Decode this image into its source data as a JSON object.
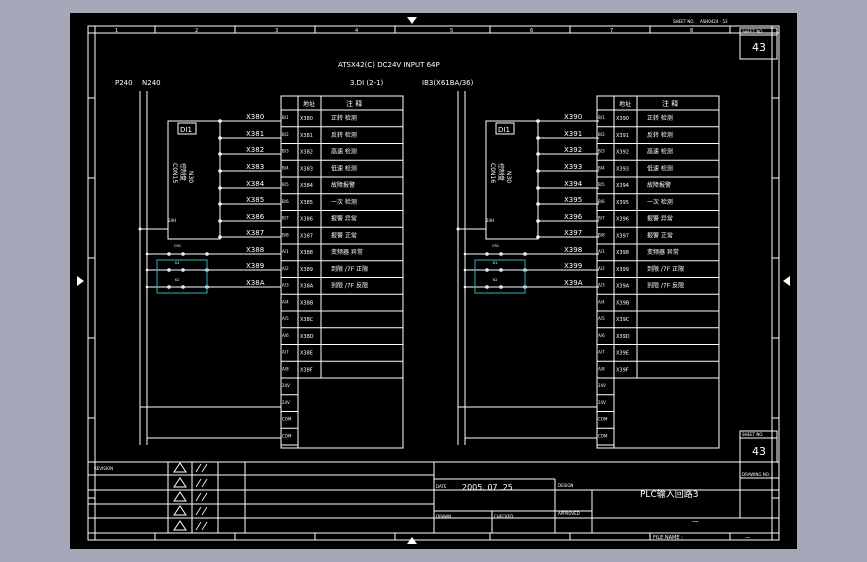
{
  "header": {
    "sheet_code_label": "SHEET NO.",
    "sheet_ref": "ASH0424 - 53",
    "sheet_no_label": "SHEET NO.",
    "sheet_no": "43",
    "title1": "ATSX42(C) DC24V INPUT 64P",
    "title2": "3.DI (2-1)",
    "title3": "IB3(X61BA/36)"
  },
  "grid_numbers": [
    "1",
    "2",
    "3",
    "4",
    "5",
    "6",
    "7",
    "8"
  ],
  "power": {
    "p": "P240",
    "n": "N240"
  },
  "left_panel": {
    "device_label": "C0N15",
    "device_sub": "控制盘",
    "device_sub2": "N30",
    "box_label": "DI1",
    "common_label": "24H",
    "aux1": "CR1",
    "aux2": "K1",
    "aux3": "K2",
    "wires": [
      "X380",
      "X381",
      "X382",
      "X383",
      "X384",
      "X385",
      "X386",
      "X387",
      "X388",
      "X389",
      "X38A"
    ]
  },
  "right_panel": {
    "device_label": "C0N16",
    "device_sub": "控制盘",
    "device_sub2": "N30",
    "box_label": "DI1",
    "common_label": "24H",
    "aux1": "CR1",
    "aux2": "K1",
    "aux3": "K2",
    "wires": [
      "X390",
      "X391",
      "X392",
      "X393",
      "X394",
      "X395",
      "X396",
      "X397",
      "X398",
      "X399",
      "X39A"
    ]
  },
  "left_table": {
    "header_addr": "地址",
    "header_desc": "注 释",
    "pins": [
      "B/1",
      "B/2",
      "B/3",
      "B/4",
      "B/5",
      "B/6",
      "B/7",
      "B/8",
      "A/1",
      "A/2",
      "A/3",
      "A/4",
      "A/5",
      "A/6",
      "A/7",
      "A/8",
      "24V",
      "24V",
      "COM",
      "COM"
    ],
    "addresses": [
      "X380",
      "X381",
      "X382",
      "X383",
      "X384",
      "X385",
      "X386",
      "X387",
      "X388",
      "X389",
      "X38A",
      "X38B",
      "X38C",
      "X38D",
      "X38E",
      "X38F",
      "",
      "",
      "",
      ""
    ],
    "descriptions": [
      "正转 检测",
      "反转 检测",
      "高速 检测",
      "低速 检测",
      "故障报警",
      "一次 检测",
      "报警 异常",
      "报警 正常",
      "变频器 异常",
      "到限 /7F 正限",
      "到限 /7F 反限",
      "",
      "",
      "",
      "",
      "",
      "",
      "",
      "",
      ""
    ]
  },
  "right_table": {
    "header_addr": "地址",
    "header_desc": "注 释",
    "pins": [
      "B/1",
      "B/2",
      "B/3",
      "B/4",
      "B/5",
      "B/6",
      "B/7",
      "B/8",
      "A/1",
      "A/2",
      "A/3",
      "A/4",
      "A/5",
      "A/6",
      "A/7",
      "A/8",
      "24V",
      "24V",
      "COM",
      "COM"
    ],
    "addresses": [
      "X390",
      "X391",
      "X392",
      "X393",
      "X394",
      "X395",
      "X396",
      "X397",
      "X398",
      "X399",
      "X39A",
      "X39B",
      "X39C",
      "X39D",
      "X39E",
      "X39F",
      "",
      "",
      "",
      ""
    ],
    "descriptions": [
      "正转 检测",
      "反转 检测",
      "高速 检测",
      "低速 检测",
      "故障报警",
      "一次 检测",
      "报警 异常",
      "报警 正常",
      "变频器 异常",
      "到限 /7F 正限",
      "到限 /7F 反限",
      "",
      "",
      "",
      "",
      "",
      "",
      "",
      "",
      ""
    ]
  },
  "title_block": {
    "revision_label": "REVISION",
    "date_label": "DATE",
    "date_value": "2005.  07  .25",
    "drawn_label": "DRAWN",
    "checked_label": "CHECKED",
    "approved_label": "APPROVED",
    "design_label": "DESIGN",
    "title": "PLC输入回路3",
    "drawing_no_label": "DRAWING NO.",
    "sheet_label": "SHEET NO.",
    "sheet_value": "43",
    "file_label": "FILE NAME :",
    "file_value": "—",
    "dash": "—"
  }
}
